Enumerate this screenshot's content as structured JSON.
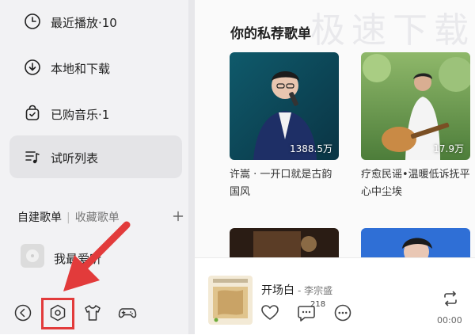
{
  "sidebar": {
    "items": [
      {
        "label": "最近播放·10",
        "icon": "clock-icon"
      },
      {
        "label": "本地和下载",
        "icon": "download-icon"
      },
      {
        "label": "已购音乐·1",
        "icon": "bag-icon"
      },
      {
        "label": "试听列表",
        "icon": "playlist-icon",
        "active": true
      }
    ],
    "section_tabs": {
      "created": "自建歌单",
      "collected": "收藏歌单"
    },
    "playlists": [
      {
        "label": "我最爱听"
      }
    ]
  },
  "bottom_tools": [
    "back-icon",
    "settings-icon",
    "skin-icon",
    "game-icon"
  ],
  "main": {
    "watermark": "极速下载",
    "title": "你的私荐歌单",
    "cards": [
      {
        "count": "1388.5万",
        "title": "许嵩 · 一开口就是古韵国风"
      },
      {
        "count": "17.9万",
        "title": "疗愈民谣•温暖低诉抚平心中尘埃"
      }
    ]
  },
  "player": {
    "song": "开场白",
    "artist": "- 李宗盛",
    "comment_count": "218",
    "time": "00:00"
  },
  "colors": {
    "highlight": "#e23b3b",
    "sidebar_bg": "#f2f2f4",
    "active_bg": "#e4e4e7"
  }
}
